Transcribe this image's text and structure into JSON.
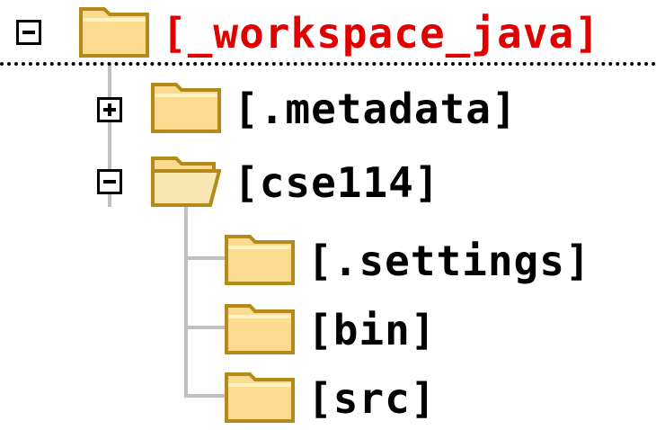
{
  "tree": {
    "root": {
      "label": "[_workspace_java]",
      "expanded": true,
      "icon": "folder-icon"
    },
    "children": [
      {
        "label": "[.metadata]",
        "expanded": false,
        "icon": "folder-icon"
      },
      {
        "label": "[cse114]",
        "expanded": true,
        "icon": "folder-open-icon",
        "children": [
          {
            "label": "[.settings]",
            "icon": "folder-icon"
          },
          {
            "label": "[bin]",
            "icon": "folder-icon"
          },
          {
            "label": "[src]",
            "icon": "folder-icon"
          }
        ]
      }
    ]
  },
  "colors": {
    "root_label": "#e00000",
    "folder_fill": "#fbdc8e",
    "folder_edge": "#b58a1a",
    "tree_lines": "#c0c0c0"
  }
}
